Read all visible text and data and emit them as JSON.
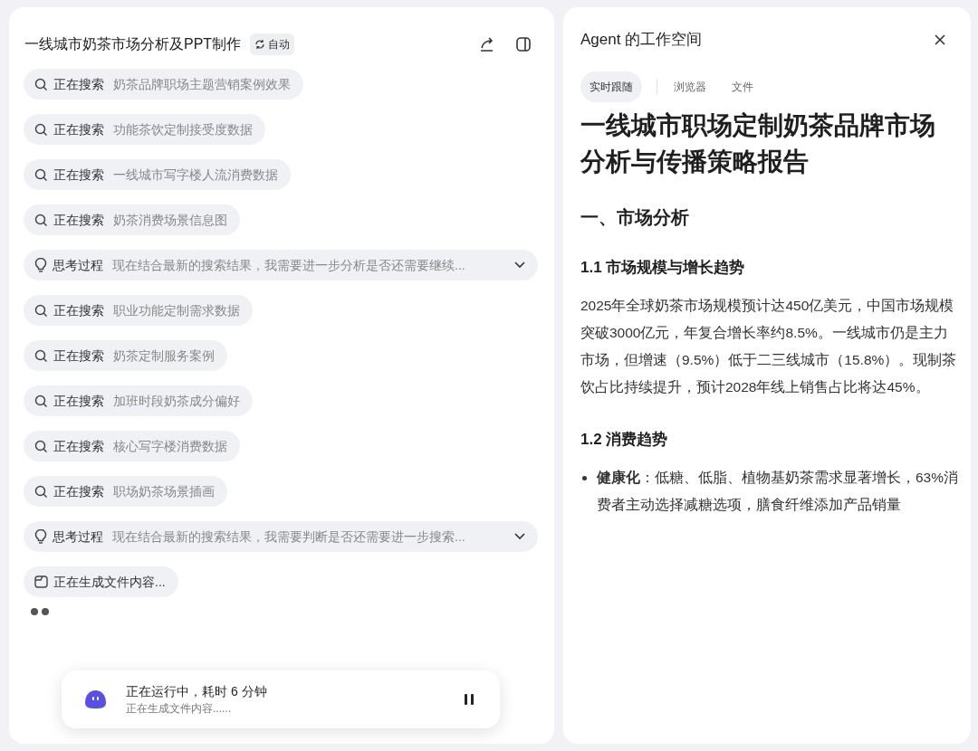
{
  "task": {
    "title": "一线城市奶茶市场分析及PPT制作",
    "mode_badge": "自动"
  },
  "steps": [
    {
      "kind": "search",
      "label": "正在搜索",
      "detail": "奶茶品牌职场主题营销案例效果"
    },
    {
      "kind": "search",
      "label": "正在搜索",
      "detail": "功能茶饮定制接受度数据"
    },
    {
      "kind": "search",
      "label": "正在搜索",
      "detail": "一线城市写字楼人流消费数据"
    },
    {
      "kind": "search",
      "label": "正在搜索",
      "detail": "奶茶消费场景信息图"
    },
    {
      "kind": "thought",
      "label": "思考过程",
      "detail": "现在结合最新的搜索结果，我需要进一步分析是否还需要继续...",
      "expanded": false
    },
    {
      "kind": "search",
      "label": "正在搜索",
      "detail": "职业功能定制需求数据"
    },
    {
      "kind": "search",
      "label": "正在搜索",
      "detail": "奶茶定制服务案例"
    },
    {
      "kind": "search",
      "label": "正在搜索",
      "detail": "加班时段奶茶成分偏好"
    },
    {
      "kind": "search",
      "label": "正在搜索",
      "detail": "核心写字楼消费数据"
    },
    {
      "kind": "search",
      "label": "正在搜索",
      "detail": "职场奶茶场景插画"
    },
    {
      "kind": "thought",
      "label": "思考过程",
      "detail": "现在结合最新的搜索结果，我需要判断是否还需要进一步搜索...",
      "expanded": false
    },
    {
      "kind": "file",
      "label": "正在生成文件内容..."
    }
  ],
  "status_card": {
    "title": "正在运行中，耗时 6 分钟",
    "subtitle": "正在生成文件内容......"
  },
  "workspace": {
    "title": "Agent 的工作空间",
    "tabs": [
      {
        "label": "实时跟随",
        "selected": true
      },
      {
        "label": "浏览器",
        "selected": false
      },
      {
        "label": "文件",
        "selected": false
      }
    ],
    "document": [
      {
        "kind": "title",
        "text": "一线城市职场定制奶茶品牌市场分析与传播策略报告"
      },
      {
        "kind": "h2",
        "text": "一、市场分析"
      },
      {
        "kind": "h3",
        "text": "1.1 市场规模与增长趋势"
      },
      {
        "kind": "p",
        "text": "2025年全球奶茶市场规模预计达450亿美元，中国市场规模突破3000亿元，年复合增长率约8.5%。一线城市仍是主力市场，但增速（9.5%）低于二三线城市（15.8%）。现制茶饮占比持续提升，预计2028年线上销售占比将达45%。"
      },
      {
        "kind": "h3",
        "text": "1.2 消费趋势"
      },
      {
        "kind": "bullet",
        "text": "**健康化**：低糖、低脂、植物基奶茶需求显著增长，63%消费者主动选择减糖选项，膳食纤维添加产品销量"
      }
    ]
  }
}
